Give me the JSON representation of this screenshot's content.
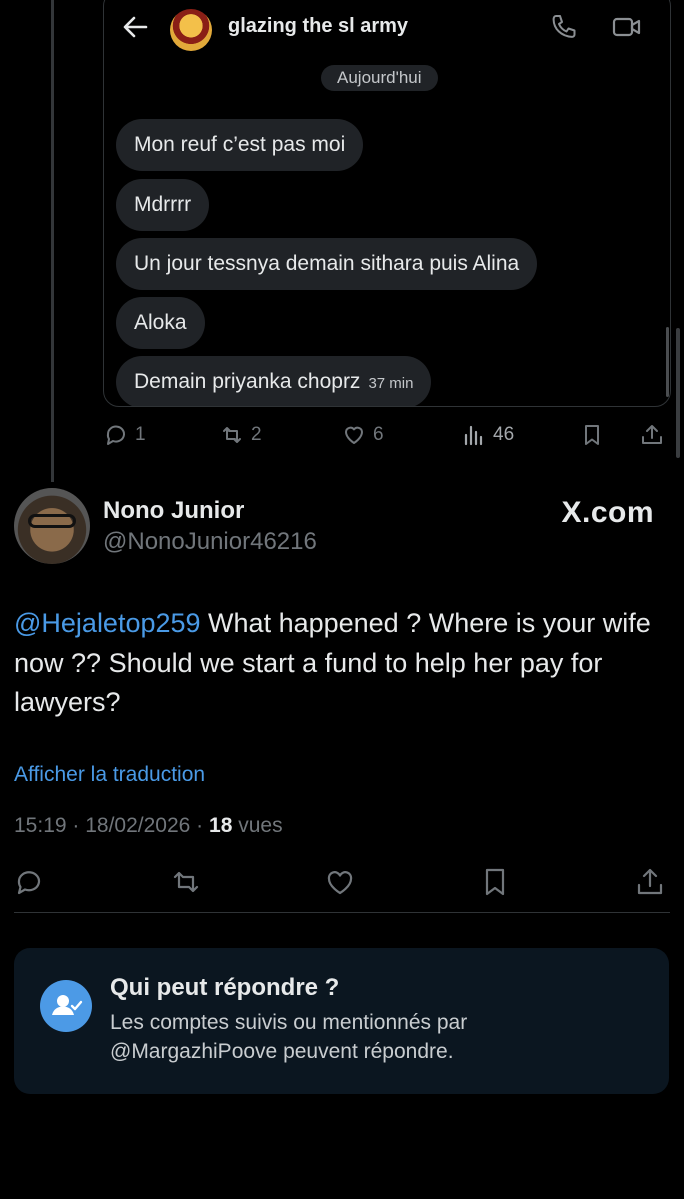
{
  "dm": {
    "title": "glazing the sl army",
    "day_label": "Aujourd'hui",
    "messages": [
      {
        "text": "Mon reuf c’est pas moi",
        "time": ""
      },
      {
        "text": "Mdrrrr",
        "time": ""
      },
      {
        "text": "Un jour tessnya demain sithara puis Alina",
        "time": ""
      },
      {
        "text": "Aloka",
        "time": ""
      },
      {
        "text": "Demain priyanka choprz",
        "time": "37 min"
      }
    ]
  },
  "quoted_metrics": {
    "replies": "1",
    "reposts": "2",
    "likes": "6",
    "views": "46"
  },
  "tweet": {
    "author_name": "Nono Junior",
    "author_handle": "@NonoJunior46216",
    "watermark": "X.com",
    "mention": "@Hejaletop259",
    "text": " What happened ? Where is your wife now ?? Should we start a fund to help her pay for lawyers?",
    "translate_label": "Afficher la traduction",
    "time": "15:19",
    "date": "18/02/2026",
    "views_count": "18",
    "views_label": "vues"
  },
  "reply_settings": {
    "title": "Qui peut répondre ?",
    "description": "Les comptes suivis ou mentionnés par @MargazhiPoove peuvent répondre."
  },
  "colors": {
    "accent": "#4a9ae6",
    "muted": "#71767b",
    "bubble": "#202327",
    "card": "#0b1620"
  }
}
